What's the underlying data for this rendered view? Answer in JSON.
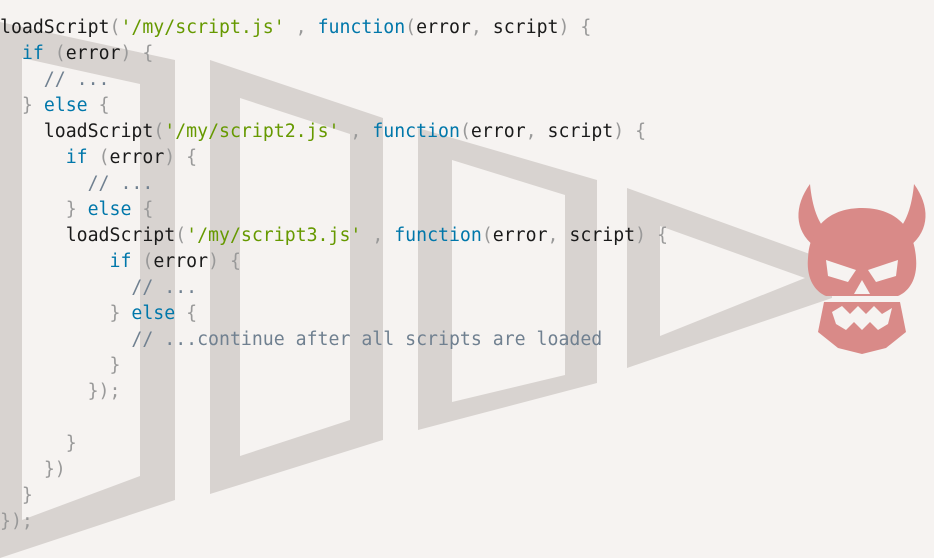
{
  "colors": {
    "background": "#f6f3f1",
    "keyword": "#0077aa",
    "string": "#669900",
    "punctuation": "#999999",
    "comment": "#708090",
    "plain": "#1a1a1a",
    "pyramid": "#d8d3d0",
    "skull": "#d98a88"
  },
  "icons": [
    "callback-pyramid-graphic",
    "horned-skull-icon"
  ],
  "code": {
    "lines": [
      [
        [
          "plain",
          "loadScript"
        ],
        [
          "punct",
          "("
        ],
        [
          "str",
          "'/my/script.js'"
        ],
        [
          "plain",
          " "
        ],
        [
          "punct",
          ","
        ],
        [
          "plain",
          " "
        ],
        [
          "kw",
          "function"
        ],
        [
          "punct",
          "("
        ],
        [
          "plain",
          "error"
        ],
        [
          "punct",
          ","
        ],
        [
          "plain",
          " script"
        ],
        [
          "punct",
          ")"
        ],
        [
          "plain",
          " "
        ],
        [
          "punct",
          "{"
        ]
      ],
      [
        [
          "plain",
          "  "
        ],
        [
          "kw",
          "if"
        ],
        [
          "plain",
          " "
        ],
        [
          "punct",
          "("
        ],
        [
          "plain",
          "error"
        ],
        [
          "punct",
          ")"
        ],
        [
          "plain",
          " "
        ],
        [
          "punct",
          "{"
        ]
      ],
      [
        [
          "cm",
          "    // ..."
        ]
      ],
      [
        [
          "plain",
          "  "
        ],
        [
          "punct",
          "}"
        ],
        [
          "plain",
          " "
        ],
        [
          "kw",
          "else"
        ],
        [
          "plain",
          " "
        ],
        [
          "punct",
          "{"
        ]
      ],
      [
        [
          "plain",
          "    loadScript"
        ],
        [
          "punct",
          "("
        ],
        [
          "str",
          "'/my/script2.js'"
        ],
        [
          "plain",
          " "
        ],
        [
          "punct",
          ","
        ],
        [
          "plain",
          " "
        ],
        [
          "kw",
          "function"
        ],
        [
          "punct",
          "("
        ],
        [
          "plain",
          "error"
        ],
        [
          "punct",
          ","
        ],
        [
          "plain",
          " script"
        ],
        [
          "punct",
          ")"
        ],
        [
          "plain",
          " "
        ],
        [
          "punct",
          "{"
        ]
      ],
      [
        [
          "plain",
          "      "
        ],
        [
          "kw",
          "if"
        ],
        [
          "plain",
          " "
        ],
        [
          "punct",
          "("
        ],
        [
          "plain",
          "error"
        ],
        [
          "punct",
          ")"
        ],
        [
          "plain",
          " "
        ],
        [
          "punct",
          "{"
        ]
      ],
      [
        [
          "cm",
          "        // ..."
        ]
      ],
      [
        [
          "plain",
          "      "
        ],
        [
          "punct",
          "}"
        ],
        [
          "plain",
          " "
        ],
        [
          "kw",
          "else"
        ],
        [
          "plain",
          " "
        ],
        [
          "punct",
          "{"
        ]
      ],
      [
        [
          "plain",
          "      loadScript"
        ],
        [
          "punct",
          "("
        ],
        [
          "str",
          "'/my/script3.js'"
        ],
        [
          "plain",
          " "
        ],
        [
          "punct",
          ","
        ],
        [
          "plain",
          " "
        ],
        [
          "kw",
          "function"
        ],
        [
          "punct",
          "("
        ],
        [
          "plain",
          "error"
        ],
        [
          "punct",
          ","
        ],
        [
          "plain",
          " script"
        ],
        [
          "punct",
          ")"
        ],
        [
          "plain",
          " "
        ],
        [
          "punct",
          "{"
        ]
      ],
      [
        [
          "plain",
          "          "
        ],
        [
          "kw",
          "if"
        ],
        [
          "plain",
          " "
        ],
        [
          "punct",
          "("
        ],
        [
          "plain",
          "error"
        ],
        [
          "punct",
          ")"
        ],
        [
          "plain",
          " "
        ],
        [
          "punct",
          "{"
        ]
      ],
      [
        [
          "cm",
          "            // ..."
        ]
      ],
      [
        [
          "plain",
          "          "
        ],
        [
          "punct",
          "}"
        ],
        [
          "plain",
          " "
        ],
        [
          "kw",
          "else"
        ],
        [
          "plain",
          " "
        ],
        [
          "punct",
          "{"
        ]
      ],
      [
        [
          "cm",
          "            // ...continue after all scripts are loaded"
        ]
      ],
      [
        [
          "plain",
          "          "
        ],
        [
          "punct",
          "}"
        ]
      ],
      [
        [
          "plain",
          "        "
        ],
        [
          "punct",
          "});"
        ]
      ],
      [
        [
          "plain",
          ""
        ]
      ],
      [
        [
          "plain",
          "      "
        ],
        [
          "punct",
          "}"
        ]
      ],
      [
        [
          "plain",
          "    "
        ],
        [
          "punct",
          "})"
        ]
      ],
      [
        [
          "plain",
          "  "
        ],
        [
          "punct",
          "}"
        ]
      ],
      [
        [
          "punct",
          "});"
        ]
      ]
    ]
  }
}
